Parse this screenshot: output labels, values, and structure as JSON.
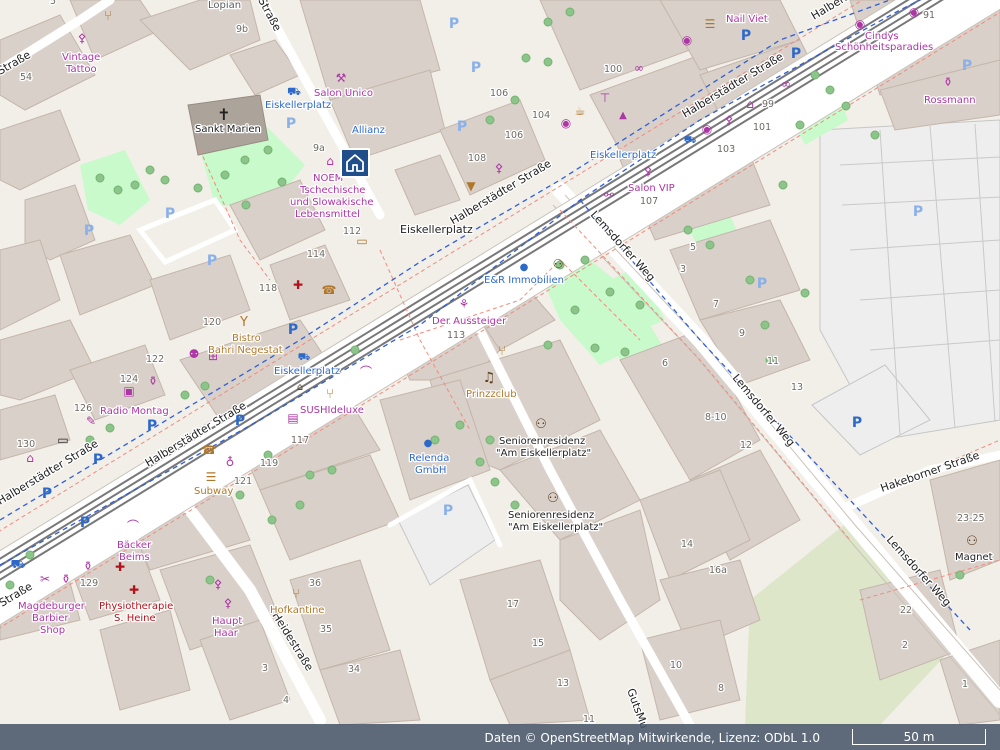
{
  "map": {
    "streets": {
      "main_upper": "Halberstädter Straße",
      "main_lower": "Halberstädter Straße",
      "main_sw": "Halberstädter Straße",
      "main_far_sw": "Halberstädter Straße",
      "lemsdorfer_upper": "Lemsdorfer Weg",
      "lemsdorfer_mid": "Lemsdorfer Weg",
      "lemsdorfer_lower": "Lemsdorfer Weg",
      "hakeborner": "Hakeborner Straße",
      "heidestrasse": "Heidestraße",
      "gutsmuths": "GutsMu",
      "north_street": "Straße",
      "north_street2": "Straße",
      "square": "Eiskellerplatz"
    },
    "stops": {
      "north": "Eiskellerplatz",
      "mid": "Eiskellerplatz",
      "south": "Eiskellerplatz"
    },
    "pois": {
      "lopian": "Lopian",
      "vintage": "Vintage",
      "tattoo": "Tattoo",
      "sankt_marien": "Sankt Marien",
      "salon_unico": "Salon Unico",
      "allianz": "Allianz",
      "noem_1": "NOEM",
      "noem_2": "Tschechische",
      "noem_3": "und Slowakische",
      "noem_4": "Lebensmittel",
      "nail_viet": "Nail Viet",
      "cindys_1": "Cindys",
      "cindys_2": "Schönheitsparadies",
      "rossmann": "Rossmann",
      "salon_vip": "Salon VIP",
      "er_immobilien": "E&R Immobilien",
      "aussteiger": "Der Aussteiger",
      "prinzzclub": "Prinzzclub",
      "bistro_1": "Bistro",
      "bistro_2": "Bahri Negestat",
      "radio_montag": "Radio Montag",
      "sushideluxe": "SUSHIdeluxe",
      "relenda_1": "Relenda",
      "relenda_2": "GmbH",
      "senior1_1": "Seniorenresidenz",
      "senior1_2": "\"Am Eiskellerplatz\"",
      "senior2_1": "Seniorenresidenz",
      "senior2_2": "\"Am Eiskellerplatz\"",
      "subway": "Subway",
      "baecker_1": "Bäcker",
      "baecker_2": "Beims",
      "physio_1": "Physiotherapie",
      "physio_2": "S. Heine",
      "barbier_1": "Magdeburger",
      "barbier_2": "Barbier",
      "barbier_3": "Shop",
      "haupt_1": "Haupt",
      "haupt_2": "Haar",
      "hofkantine": "Hofkantine",
      "magnet": "Magnet"
    },
    "house_numbers": {
      "n5": "5",
      "n9b": "9b",
      "n54": "54",
      "n9a": "9a",
      "n112": "112",
      "n114": "114",
      "n118": "118",
      "n120": "120",
      "n122": "122",
      "n124": "124",
      "n126": "126",
      "n130": "130",
      "n129": "129",
      "n117": "117",
      "n119": "119",
      "n121": "121",
      "n113": "113",
      "n108": "108",
      "n106a": "106",
      "n106b": "106",
      "n104": "104",
      "n100": "100",
      "n99": "99",
      "n101": "101",
      "n103": "103",
      "n107": "107",
      "n91": "91",
      "n3a": "3",
      "n5b": "5",
      "n7": "7",
      "n9": "9",
      "n11": "11",
      "n13": "13",
      "n6": "6",
      "n810": "8-10",
      "n12": "12",
      "n14": "14",
      "n16a": "16a",
      "n2325": "23-25",
      "n22": "22",
      "n2": "2",
      "n1": "1",
      "n36": "36",
      "n35": "35",
      "n34": "34",
      "n3c": "3",
      "n4": "4",
      "n17": "17",
      "n15": "15",
      "n13b": "13",
      "n11b": "11",
      "n10": "10",
      "n8": "8"
    }
  },
  "footer": {
    "attribution": "Daten © OpenStreetMap Mitwirkende, Lizenz: ODbL 1.0",
    "scale_label": "50 m"
  },
  "colors": {
    "background": "#f2efe9",
    "building": "#d9d0c9",
    "park": "#c8facc",
    "road": "#ffffff",
    "road_casing": "#c9c3ba",
    "tram": "#787878",
    "bus_route": "#2f5ed8",
    "poi_purple": "#ad35a6",
    "poi_blue": "#2d69c9",
    "poi_orange": "#b0772a",
    "poi_red": "#b3131d"
  }
}
